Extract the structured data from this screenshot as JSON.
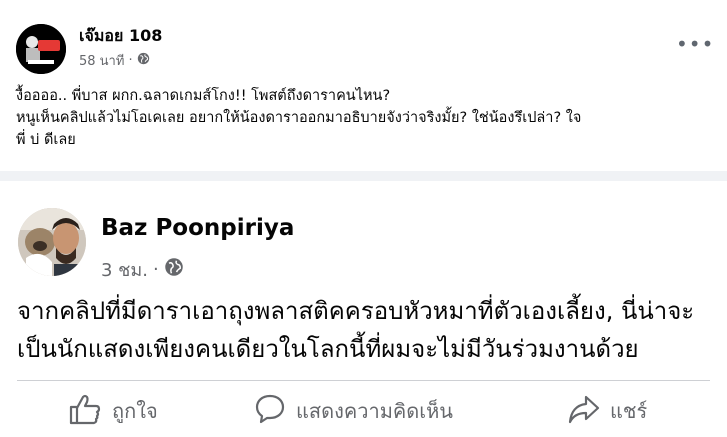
{
  "top_post": {
    "author_name": "เจ๊มอย 108",
    "timestamp": "58 นาที",
    "separator": "·",
    "audience_icon": "globe-icon",
    "more_icon": "more-options-icon",
    "more_label": "•••",
    "lines": [
      "งื้ออออ.. พี่บาส ผกก.ฉลาดเกมส์โกง!! โพสต์ถึงดาราคนไหน?",
      "หนูเห็นคลิปแล้วไม่โอเคเลย อยากให้น้องดาราออกมาอธิบายจังว่าจริงมั้ย? ใช่น้องรึเปล่า? ใจ",
      "พี่ บ่ ดีเลย"
    ]
  },
  "shared_post": {
    "author_name": "Baz Poonpiriya",
    "timestamp": "3 ชม.",
    "separator": "·",
    "audience_icon": "globe-icon",
    "lines": [
      "จากคลิปที่มีดาราเอาถุงพลาสติคครอบหัวหมาที่ตัวเองเลี้ยง, นี่น่าจะ",
      "เป็นนักแสดงเพียงคนเดียวในโลกนี้ที่ผมจะไม่มีวันร่วมงานด้วย"
    ]
  },
  "actions": {
    "like_label": "ถูกใจ",
    "comment_label": "แสดงความคิดเห็น",
    "share_label": "แชร์"
  },
  "colors": {
    "background": "#f0f2f5",
    "card": "#ffffff",
    "secondary_text": "#65676b",
    "primary_text": "#050505"
  }
}
